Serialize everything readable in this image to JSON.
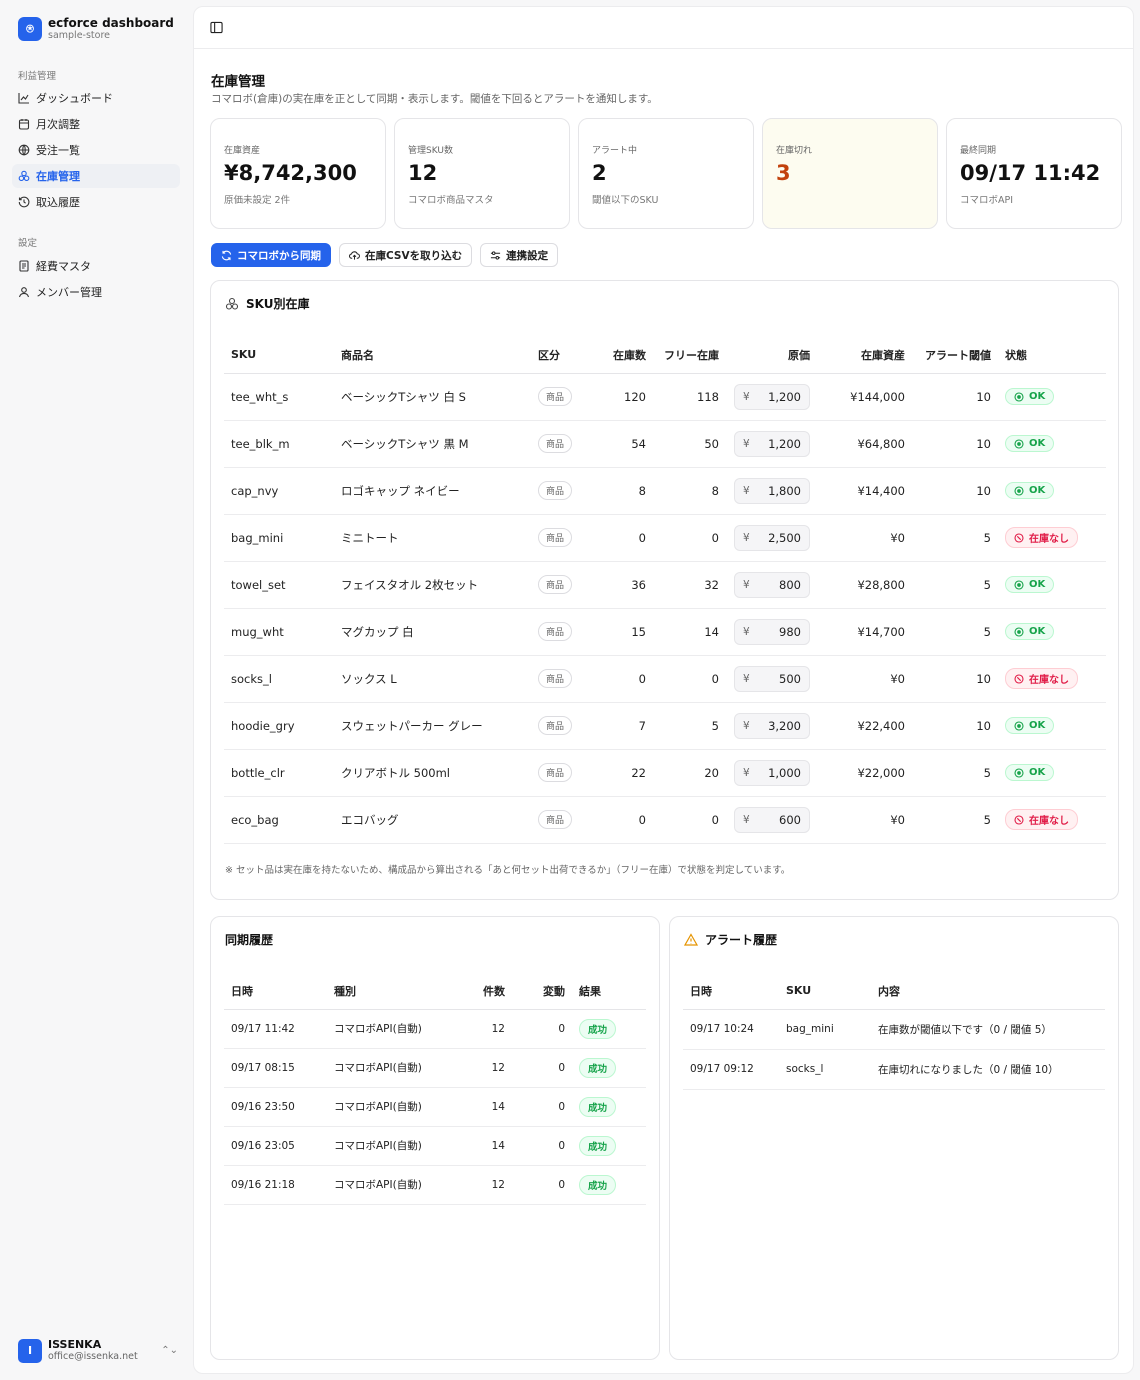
{
  "brand": {
    "logo": "⍟",
    "name": "ecforce dashboard",
    "store": "sample-store"
  },
  "sidebar": {
    "group1_label": "利益管理",
    "group1_items": [
      {
        "label": "ダッシュボード",
        "icon": "chart-line-icon"
      },
      {
        "label": "月次調整",
        "icon": "calendar-icon"
      },
      {
        "label": "受注一覧",
        "icon": "globe-icon"
      },
      {
        "label": "在庫管理",
        "icon": "boxes-icon",
        "active": true
      },
      {
        "label": "取込履歴",
        "icon": "history-icon"
      }
    ],
    "group2_label": "設定",
    "group2_items": [
      {
        "label": "経費マスタ",
        "icon": "receipt-icon"
      },
      {
        "label": "メンバー管理",
        "icon": "users-icon"
      }
    ]
  },
  "user": {
    "initial": "I",
    "name": "ISSENKA",
    "email": "office@issenka.net"
  },
  "page": {
    "title": "在庫管理",
    "description": "コマロボ(倉庫)の実在庫を正として同期・表示します。閾値を下回るとアラートを通知します。"
  },
  "kpis": [
    {
      "label": "在庫資産",
      "value": "¥8,742,300",
      "sub": "原価未設定 2件"
    },
    {
      "label": "管理SKU数",
      "value": "12",
      "sub": "コマロボ商品マスタ"
    },
    {
      "label": "アラート中",
      "value": "2",
      "sub": "閾値以下のSKU"
    },
    {
      "label": "在庫切れ",
      "value": "3",
      "sub": ""
    },
    {
      "label": "最終同期",
      "value": "09/17 11:42",
      "sub": "コマロボAPI"
    }
  ],
  "actions": {
    "sync": "コマロボから同期",
    "import_csv": "在庫CSVを取り込む",
    "settings": "連携設定"
  },
  "sku_card": {
    "title": "SKU別在庫",
    "columns": [
      "SKU",
      "商品名",
      "区分",
      "在庫数",
      "フリー在庫",
      "原価",
      "在庫資産",
      "アラート閾値",
      "状態"
    ],
    "currency": "¥",
    "rows": [
      {
        "sku": "tee_wht_s",
        "name": "ベーシックTシャツ 白 S",
        "type": "商品",
        "stock": "120",
        "free": "118",
        "cost": "1,200",
        "asset": "¥144,000",
        "threshold": "10",
        "status": "OK",
        "status_kind": "ok"
      },
      {
        "sku": "tee_blk_m",
        "name": "ベーシックTシャツ 黒 M",
        "type": "商品",
        "stock": "54",
        "free": "50",
        "cost": "1,200",
        "asset": "¥64,800",
        "threshold": "10",
        "status": "OK",
        "status_kind": "ok"
      },
      {
        "sku": "cap_nvy",
        "name": "ロゴキャップ ネイビー",
        "type": "商品",
        "stock": "8",
        "free": "8",
        "cost": "1,800",
        "asset": "¥14,400",
        "threshold": "10",
        "status": "OK",
        "status_kind": "ok"
      },
      {
        "sku": "bag_mini",
        "name": "ミニトート",
        "type": "商品",
        "stock": "0",
        "free": "0",
        "cost": "2,500",
        "asset": "¥0",
        "threshold": "5",
        "status": "在庫なし",
        "status_kind": "none"
      },
      {
        "sku": "towel_set",
        "name": "フェイスタオル 2枚セット",
        "type": "商品",
        "stock": "36",
        "free": "32",
        "cost": "800",
        "asset": "¥28,800",
        "threshold": "5",
        "status": "OK",
        "status_kind": "ok"
      },
      {
        "sku": "mug_wht",
        "name": "マグカップ 白",
        "type": "商品",
        "stock": "15",
        "free": "14",
        "cost": "980",
        "asset": "¥14,700",
        "threshold": "5",
        "status": "OK",
        "status_kind": "ok"
      },
      {
        "sku": "socks_l",
        "name": "ソックス L",
        "type": "商品",
        "stock": "0",
        "free": "0",
        "cost": "500",
        "asset": "¥0",
        "threshold": "10",
        "status": "在庫なし",
        "status_kind": "none"
      },
      {
        "sku": "hoodie_gry",
        "name": "スウェットパーカー グレー",
        "type": "商品",
        "stock": "7",
        "free": "5",
        "cost": "3,200",
        "asset": "¥22,400",
        "threshold": "10",
        "status": "OK",
        "status_kind": "ok"
      },
      {
        "sku": "bottle_clr",
        "name": "クリアボトル 500ml",
        "type": "商品",
        "stock": "22",
        "free": "20",
        "cost": "1,000",
        "asset": "¥22,000",
        "threshold": "5",
        "status": "OK",
        "status_kind": "ok"
      },
      {
        "sku": "eco_bag",
        "name": "エコバッグ",
        "type": "商品",
        "stock": "0",
        "free": "0",
        "cost": "600",
        "asset": "¥0",
        "threshold": "5",
        "status": "在庫なし",
        "status_kind": "none"
      }
    ],
    "note": "※ セット品は実在庫を持たないため、構成品から算出される「あと何セット出荷できるか」（フリー在庫）で状態を判定しています。"
  },
  "sync_history": {
    "title": "同期履歴",
    "columns": [
      "日時",
      "種別",
      "件数",
      "変動",
      "結果"
    ],
    "rows": [
      {
        "time": "09/17 11:42",
        "kind": "コマロボAPI(自動)",
        "count": "12",
        "change": "0",
        "result": "成功"
      },
      {
        "time": "09/17 08:15",
        "kind": "コマロボAPI(自動)",
        "count": "12",
        "change": "0",
        "result": "成功"
      },
      {
        "time": "09/16 23:50",
        "kind": "コマロボAPI(自動)",
        "count": "14",
        "change": "0",
        "result": "成功"
      },
      {
        "time": "09/16 23:05",
        "kind": "コマロボAPI(自動)",
        "count": "14",
        "change": "0",
        "result": "成功"
      },
      {
        "time": "09/16 21:18",
        "kind": "コマロボAPI(自動)",
        "count": "12",
        "change": "0",
        "result": "成功"
      }
    ]
  },
  "alert_history": {
    "title": "アラート履歴",
    "columns": [
      "日時",
      "SKU",
      "内容"
    ],
    "rows": [
      {
        "time": "09/17 10:24",
        "sku": "bag_mini",
        "content": "在庫数が閾値以下です（0 / 閾値 5）"
      },
      {
        "time": "09/17 09:12",
        "sku": "socks_l",
        "content": "在庫切れになりました（0 / 閾値 10）"
      }
    ]
  },
  "colors": {
    "accent": "#2563eb",
    "ok": "#16a34a",
    "danger": "#e11d48",
    "warn_value": "#c2410c",
    "warn_bg": "#fdfcf0"
  }
}
